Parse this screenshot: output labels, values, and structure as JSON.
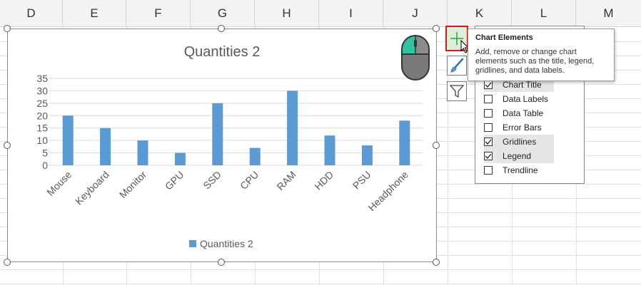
{
  "sheet": {
    "columns": [
      "D",
      "E",
      "F",
      "G",
      "H",
      "I",
      "J",
      "K",
      "L",
      "M"
    ]
  },
  "chart_data": {
    "type": "bar",
    "title": "Quantities 2",
    "categories": [
      "Mouse",
      "Keyboard",
      "Monitor",
      "GPU",
      "SSD",
      "CPU",
      "RAM",
      "HDD",
      "PSU",
      "Headphone"
    ],
    "series": [
      {
        "name": "Quantities 2",
        "values": [
          20,
          15,
          10,
          5,
          25,
          7,
          30,
          12,
          8,
          18
        ]
      }
    ],
    "yticks": [
      "0",
      "5",
      "10",
      "15",
      "20",
      "25",
      "30",
      "35"
    ],
    "ylim": [
      0,
      35
    ],
    "grid": true,
    "legend_position": "bottom",
    "bar_color": "#5b9bd5"
  },
  "chart_buttons": {
    "elements": "plus-icon",
    "styles": "brush-icon",
    "filters": "filter-icon"
  },
  "tooltip": {
    "title": "Chart Elements",
    "body": "Add, remove or change chart elements such as the title, legend, gridlines, and data labels."
  },
  "elements_panel": {
    "items": [
      {
        "label": "Chart Title",
        "checked": true
      },
      {
        "label": "Data Labels",
        "checked": false
      },
      {
        "label": "Data Table",
        "checked": false
      },
      {
        "label": "Error Bars",
        "checked": false
      },
      {
        "label": "Gridlines",
        "checked": true
      },
      {
        "label": "Legend",
        "checked": true
      },
      {
        "label": "Trendline",
        "checked": false
      }
    ]
  },
  "colors": {
    "highlight_border": "#e0151b",
    "mouse_accent": "#2ec4a0"
  }
}
